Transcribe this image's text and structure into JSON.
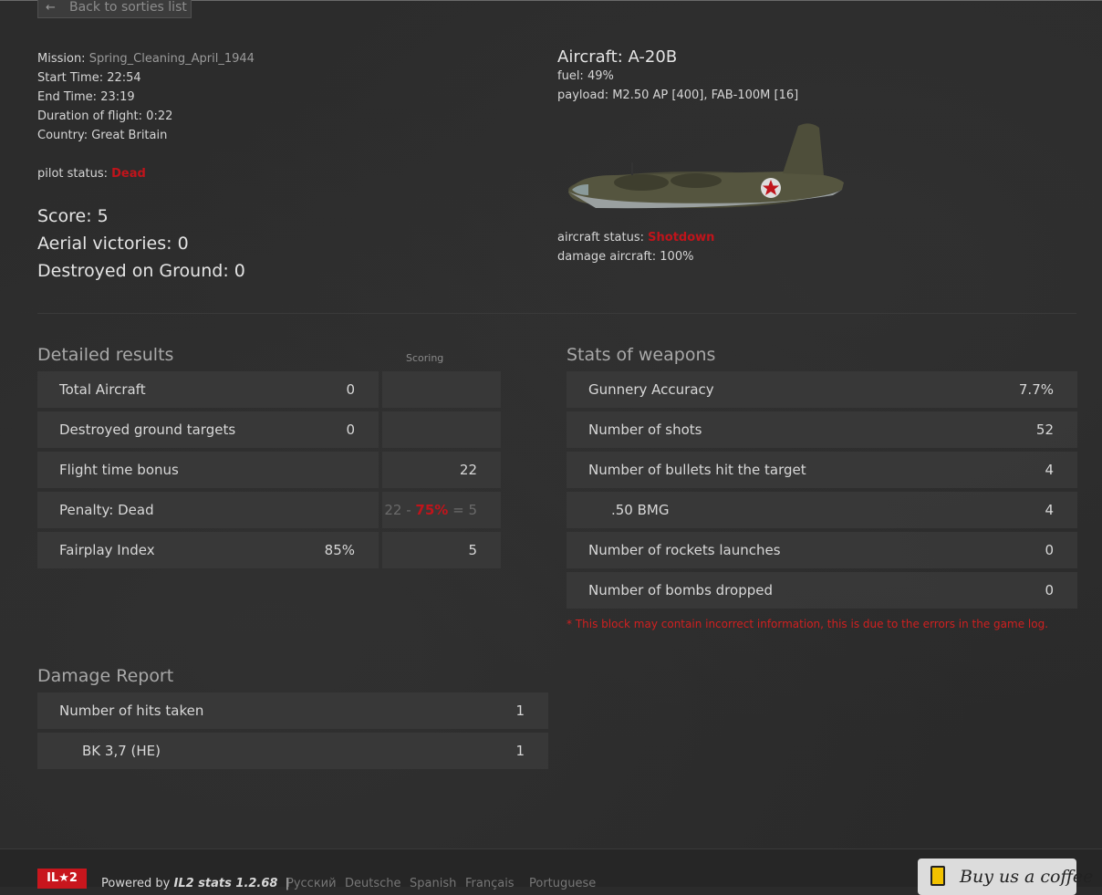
{
  "back_button": {
    "label": "Back to sorties list"
  },
  "mission": {
    "mission_label": "Mission:",
    "mission_value": "Spring_Cleaning_April_1944",
    "start_label": "Start Time:",
    "start_value": "22:54",
    "end_label": "End Time:",
    "end_value": "23:19",
    "duration_label": "Duration of flight:",
    "duration_value": "0:22",
    "country_label": "Country:",
    "country_value": "Great Britain",
    "pilot_status_label": "pilot status:",
    "pilot_status_value": "Dead"
  },
  "summary": {
    "score": "Score: 5",
    "aerial_victories": "Aerial victories: 0",
    "destroyed_ground": "Destroyed on Ground: 0"
  },
  "aircraft": {
    "title": "Aircraft: A-20B",
    "fuel": "fuel: 49%",
    "payload": "payload: M2.50 AP [400], FAB-100M [16]",
    "status_label": "aircraft status:",
    "status_value": "Shotdown",
    "damage": "damage aircraft: 100%"
  },
  "detailed_results": {
    "title": "Detailed results",
    "scoring_label": "Scoring",
    "rows": [
      {
        "label": "Total Aircraft",
        "value": "0",
        "score": ""
      },
      {
        "label": "Destroyed ground targets",
        "value": "0",
        "score": ""
      },
      {
        "label": "Flight time bonus",
        "value": "",
        "score": "22"
      },
      {
        "label": "Penalty: Dead",
        "value": "",
        "score_a": "22 -",
        "score_b": "75%",
        "score_c": "= 5"
      },
      {
        "label": "Fairplay Index",
        "value": "85%",
        "score": "5"
      }
    ]
  },
  "weapons": {
    "title": "Stats of weapons",
    "rows": [
      {
        "label": "Gunnery Accuracy",
        "value": "7.7%"
      },
      {
        "label": "Number of shots",
        "value": "52"
      },
      {
        "label": "Number of bullets hit the target",
        "value": "4"
      },
      {
        "label": ".50 BMG",
        "value": "4"
      },
      {
        "label": "Number of rockets launches",
        "value": "0"
      },
      {
        "label": "Number of bombs dropped",
        "value": "0"
      }
    ],
    "note": "* This block may contain incorrect information, this is due to the errors in the game log."
  },
  "damage_report": {
    "title": "Damage Report",
    "rows": [
      {
        "label": "Number of hits taken",
        "value": "1"
      },
      {
        "label": "BK 3,7 (HE)",
        "value": "1"
      }
    ]
  },
  "footer": {
    "logo": "IL★2",
    "powered_prefix": "Powered by",
    "powered_brand": "IL2 stats 1.2.68",
    "separator": "|",
    "languages": [
      "Русский",
      "Deutsche",
      "Spanish",
      "Français",
      "Portuguese"
    ],
    "coffee_label": "Buy us a coffee"
  },
  "colors": {
    "accent_red": "#c0141b",
    "panel": "#3a3a3a",
    "background": "#2b2b2b"
  }
}
